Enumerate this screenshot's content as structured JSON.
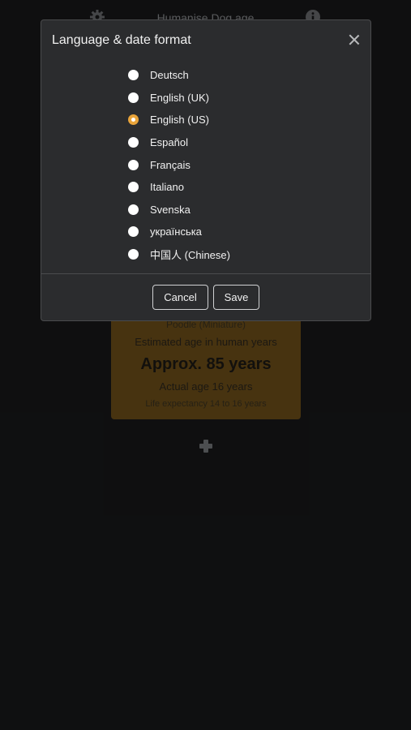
{
  "app": {
    "title": "Humanise Dog age",
    "settings_icon": "gear-icon",
    "info_icon": "info-icon"
  },
  "dog_card": {
    "breed": "Poodle (Miniature)",
    "estimate_label": "Estimated age in human years",
    "approx_age": "Approx. 85 years",
    "actual_age": "Actual age 16 years",
    "life_expectancy": "Life expectancy 14 to 16 years",
    "color": "#6e4f1a"
  },
  "add_button_icon": "plus-icon",
  "modal": {
    "title": "Language & date format",
    "close_icon": "close-icon",
    "options": [
      {
        "label": "Deutsch",
        "selected": false
      },
      {
        "label": "English (UK)",
        "selected": false
      },
      {
        "label": "English (US)",
        "selected": true
      },
      {
        "label": "Español",
        "selected": false
      },
      {
        "label": "Français",
        "selected": false
      },
      {
        "label": "Italiano",
        "selected": false
      },
      {
        "label": "Svenska",
        "selected": false
      },
      {
        "label": "українська",
        "selected": false
      },
      {
        "label": "中国人 (Chinese)",
        "selected": false
      }
    ],
    "cancel_label": "Cancel",
    "save_label": "Save",
    "accent_color": "#e9a43a"
  }
}
